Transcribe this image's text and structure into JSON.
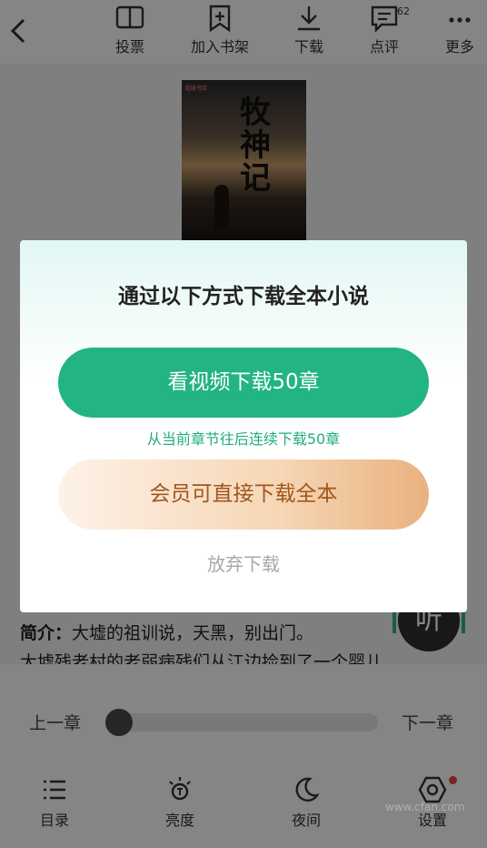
{
  "toolbar": {
    "items": [
      {
        "label": "投票",
        "icon": "vote-icon"
      },
      {
        "label": "加入书架",
        "icon": "add-to-shelf-icon"
      },
      {
        "label": "下载",
        "icon": "download-icon"
      },
      {
        "label": "点评",
        "icon": "comment-icon",
        "badge": "62"
      },
      {
        "label": "更多",
        "icon": "more-icon"
      }
    ]
  },
  "book": {
    "cover_tag": "超级书库",
    "cover_title": "牧神记",
    "intro_label": "简介：",
    "intro_line1": "大墟的祖训说，天黑，别出门。",
    "intro_line2": "大墟残老村的老弱病残们从江边捡到了一个婴儿"
  },
  "listen_button": {
    "label": "听"
  },
  "dialog": {
    "title": "通过以下方式下载全本小说",
    "video_button": "看视频下载50章",
    "video_note": "从当前章节往后连续下载50章",
    "vip_button": "会员可直接下载全本",
    "give_up": "放弃下载"
  },
  "reader_controls": {
    "prev_chapter": "上一章",
    "next_chapter": "下一章",
    "progress_fraction": 0.0,
    "nav": [
      {
        "label": "目录",
        "icon": "toc-icon"
      },
      {
        "label": "亮度",
        "icon": "brightness-icon"
      },
      {
        "label": "夜间",
        "icon": "night-mode-icon"
      },
      {
        "label": "设置",
        "icon": "settings-icon"
      }
    ]
  },
  "watermark": "www.cfan.com",
  "colors": {
    "accent_green": "#22b483",
    "vip_text": "#a0561c",
    "notification_dot": "#e84a3e"
  }
}
